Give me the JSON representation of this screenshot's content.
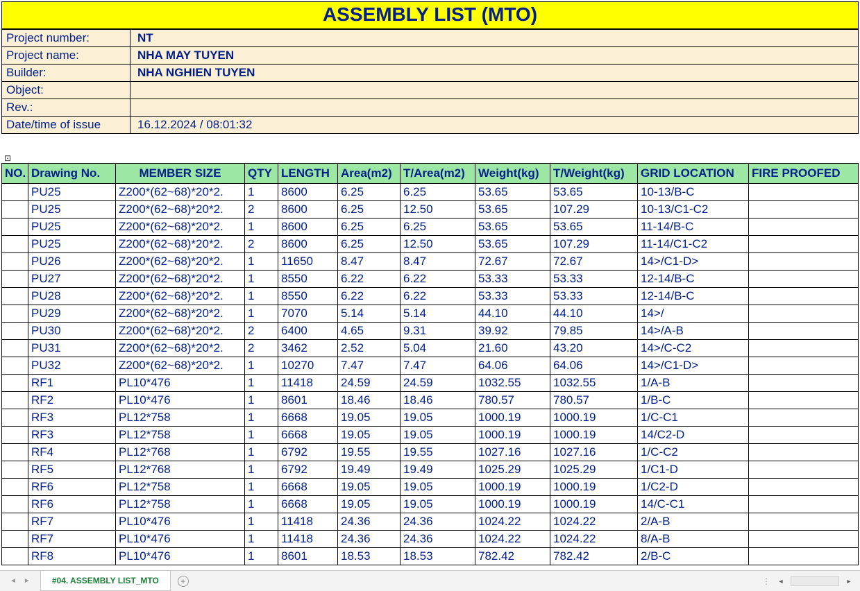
{
  "title": "ASSEMBLY LIST (MTO)",
  "info": {
    "project_number_label": "Project number:",
    "project_number_value": "NT",
    "project_name_label": "Project name:",
    "project_name_value": "NHA MAY TUYEN",
    "builder_label": "Builder:",
    "builder_value": "NHA NGHIEN TUYEN",
    "object_label": "Object:",
    "object_value": "",
    "rev_label": "Rev.:",
    "rev_value": "",
    "datetime_label": "Date/time of issue",
    "datetime_value": "16.12.2024 / 08:01:32"
  },
  "collapse_glyph": "⊡",
  "columns": {
    "no": "NO.",
    "drawing": "Drawing No.",
    "member": "MEMBER SIZE",
    "qty": "QTY",
    "length": "LENGTH",
    "area": "Area(m2)",
    "tarea": "T/Area(m2)",
    "weight": "Weight(kg)",
    "tweight": "T/Weight(kg)",
    "grid": "GRID LOCATION",
    "fire": "FIRE PROOFED"
  },
  "rows": [
    {
      "no": "",
      "drawing": "PU25",
      "member": "Z200*(62~68)*20*2.",
      "qty": "1",
      "length": "8600",
      "area": "6.25",
      "tarea": "6.25",
      "weight": "53.65",
      "tweight": "53.65",
      "grid": "10-13/B-C",
      "fire": ""
    },
    {
      "no": "",
      "drawing": "PU25",
      "member": "Z200*(62~68)*20*2.",
      "qty": "2",
      "length": "8600",
      "area": "6.25",
      "tarea": "12.50",
      "weight": "53.65",
      "tweight": "107.29",
      "grid": "10-13/C1-C2",
      "fire": ""
    },
    {
      "no": "",
      "drawing": "PU25",
      "member": "Z200*(62~68)*20*2.",
      "qty": "1",
      "length": "8600",
      "area": "6.25",
      "tarea": "6.25",
      "weight": "53.65",
      "tweight": "53.65",
      "grid": "11-14/B-C",
      "fire": ""
    },
    {
      "no": "",
      "drawing": "PU25",
      "member": "Z200*(62~68)*20*2.",
      "qty": "2",
      "length": "8600",
      "area": "6.25",
      "tarea": "12.50",
      "weight": "53.65",
      "tweight": "107.29",
      "grid": "11-14/C1-C2",
      "fire": ""
    },
    {
      "no": "",
      "drawing": "PU26",
      "member": "Z200*(62~68)*20*2.",
      "qty": "1",
      "length": "11650",
      "area": "8.47",
      "tarea": "8.47",
      "weight": "72.67",
      "tweight": "72.67",
      "grid": "14>/C1-D>",
      "fire": ""
    },
    {
      "no": "",
      "drawing": "PU27",
      "member": "Z200*(62~68)*20*2.",
      "qty": "1",
      "length": "8550",
      "area": "6.22",
      "tarea": "6.22",
      "weight": "53.33",
      "tweight": "53.33",
      "grid": "12-14/B-C",
      "fire": ""
    },
    {
      "no": "",
      "drawing": "PU28",
      "member": "Z200*(62~68)*20*2.",
      "qty": "1",
      "length": "8550",
      "area": "6.22",
      "tarea": "6.22",
      "weight": "53.33",
      "tweight": "53.33",
      "grid": "12-14/B-C",
      "fire": ""
    },
    {
      "no": "",
      "drawing": "PU29",
      "member": "Z200*(62~68)*20*2.",
      "qty": "1",
      "length": "7070",
      "area": "5.14",
      "tarea": "5.14",
      "weight": "44.10",
      "tweight": "44.10",
      "grid": "14>/",
      "fire": ""
    },
    {
      "no": "",
      "drawing": "PU30",
      "member": "Z200*(62~68)*20*2.",
      "qty": "2",
      "length": "6400",
      "area": "4.65",
      "tarea": "9.31",
      "weight": "39.92",
      "tweight": "79.85",
      "grid": "14>/A-B",
      "fire": ""
    },
    {
      "no": "",
      "drawing": "PU31",
      "member": "Z200*(62~68)*20*2.",
      "qty": "2",
      "length": "3462",
      "area": "2.52",
      "tarea": "5.04",
      "weight": "21.60",
      "tweight": "43.20",
      "grid": "14>/C-C2",
      "fire": ""
    },
    {
      "no": "",
      "drawing": "PU32",
      "member": "Z200*(62~68)*20*2.",
      "qty": "1",
      "length": "10270",
      "area": "7.47",
      "tarea": "7.47",
      "weight": "64.06",
      "tweight": "64.06",
      "grid": "14>/C1-D>",
      "fire": ""
    },
    {
      "no": "",
      "drawing": "RF1",
      "member": "PL10*476",
      "qty": "1",
      "length": "11418",
      "area": "24.59",
      "tarea": "24.59",
      "weight": "1032.55",
      "tweight": "1032.55",
      "grid": "1/A-B",
      "fire": ""
    },
    {
      "no": "",
      "drawing": "RF2",
      "member": "PL10*476",
      "qty": "1",
      "length": "8601",
      "area": "18.46",
      "tarea": "18.46",
      "weight": "780.57",
      "tweight": "780.57",
      "grid": "1/B-C",
      "fire": ""
    },
    {
      "no": "",
      "drawing": "RF3",
      "member": "PL12*758",
      "qty": "1",
      "length": "6668",
      "area": "19.05",
      "tarea": "19.05",
      "weight": "1000.19",
      "tweight": "1000.19",
      "grid": "1/C-C1",
      "fire": ""
    },
    {
      "no": "",
      "drawing": "RF3",
      "member": "PL12*758",
      "qty": "1",
      "length": "6668",
      "area": "19.05",
      "tarea": "19.05",
      "weight": "1000.19",
      "tweight": "1000.19",
      "grid": "14/C2-D",
      "fire": ""
    },
    {
      "no": "",
      "drawing": "RF4",
      "member": "PL12*768",
      "qty": "1",
      "length": "6792",
      "area": "19.55",
      "tarea": "19.55",
      "weight": "1027.16",
      "tweight": "1027.16",
      "grid": "1/C-C2",
      "fire": ""
    },
    {
      "no": "",
      "drawing": "RF5",
      "member": "PL12*768",
      "qty": "1",
      "length": "6792",
      "area": "19.49",
      "tarea": "19.49",
      "weight": "1025.29",
      "tweight": "1025.29",
      "grid": "1/C1-D",
      "fire": ""
    },
    {
      "no": "",
      "drawing": "RF6",
      "member": "PL12*758",
      "qty": "1",
      "length": "6668",
      "area": "19.05",
      "tarea": "19.05",
      "weight": "1000.19",
      "tweight": "1000.19",
      "grid": "1/C2-D",
      "fire": ""
    },
    {
      "no": "",
      "drawing": "RF6",
      "member": "PL12*758",
      "qty": "1",
      "length": "6668",
      "area": "19.05",
      "tarea": "19.05",
      "weight": "1000.19",
      "tweight": "1000.19",
      "grid": "14/C-C1",
      "fire": ""
    },
    {
      "no": "",
      "drawing": "RF7",
      "member": "PL10*476",
      "qty": "1",
      "length": "11418",
      "area": "24.36",
      "tarea": "24.36",
      "weight": "1024.22",
      "tweight": "1024.22",
      "grid": "2/A-B",
      "fire": ""
    },
    {
      "no": "",
      "drawing": "RF7",
      "member": "PL10*476",
      "qty": "1",
      "length": "11418",
      "area": "24.36",
      "tarea": "24.36",
      "weight": "1024.22",
      "tweight": "1024.22",
      "grid": "8/A-B",
      "fire": ""
    },
    {
      "no": "",
      "drawing": "RF8",
      "member": "PL10*476",
      "qty": "1",
      "length": "8601",
      "area": "18.53",
      "tarea": "18.53",
      "weight": "782.42",
      "tweight": "782.42",
      "grid": "2/B-C",
      "fire": ""
    }
  ],
  "tabbar": {
    "active_tab": "#04. ASSEMBLY LIST_MTO"
  }
}
